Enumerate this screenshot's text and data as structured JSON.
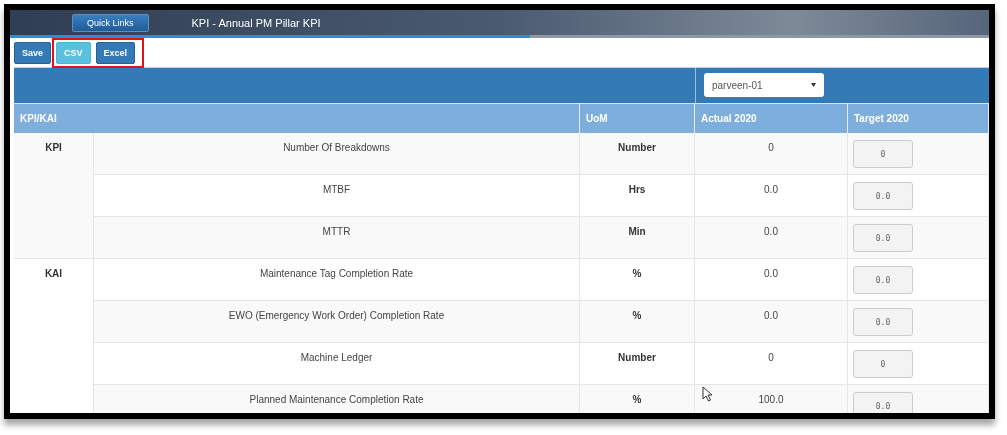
{
  "header": {
    "quick_links": "Quick Links",
    "title": "KPI - Annual PM Pillar KPI"
  },
  "toolbar": [
    {
      "label": "Save",
      "kind": "primary"
    },
    {
      "label": "CSV",
      "kind": "info"
    },
    {
      "label": "Excel",
      "kind": "primary"
    }
  ],
  "user_select": {
    "value": "parveen-01"
  },
  "table": {
    "columns": [
      "KPI/KAI",
      "UoM",
      "Actual 2020",
      "Target 2020"
    ],
    "groups": [
      {
        "name": "KPI",
        "rows": [
          {
            "metric": "Number Of Breakdowns",
            "uom": "Number",
            "actual": "0",
            "target": "0"
          },
          {
            "metric": "MTBF",
            "uom": "Hrs",
            "actual": "0.0",
            "target": "0.0"
          },
          {
            "metric": "MTTR",
            "uom": "Min",
            "actual": "0.0",
            "target": "0.0"
          }
        ]
      },
      {
        "name": "KAI",
        "rows": [
          {
            "metric": "Maintenance Tag Completion Rate",
            "uom": "%",
            "actual": "0.0",
            "target": "0.0"
          },
          {
            "metric": "EWO (Emergency Work Order) Completion Rate",
            "uom": "%",
            "actual": "0.0",
            "target": "0.0"
          },
          {
            "metric": "Machine Ledger",
            "uom": "Number",
            "actual": "0",
            "target": "0"
          },
          {
            "metric": "Planned Maintenance Completion Rate",
            "uom": "%",
            "actual": "100.0",
            "target": "0.0"
          }
        ]
      }
    ]
  }
}
